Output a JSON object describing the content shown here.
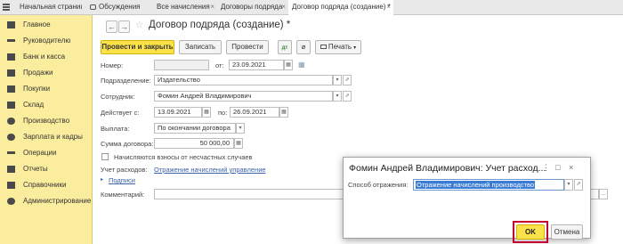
{
  "tabs": [
    {
      "label": "Начальная страница"
    },
    {
      "label": "Обсуждения"
    },
    {
      "label": "Все начисления"
    },
    {
      "label": "Договоры подряда"
    },
    {
      "label": "Договор подряда (создание) *"
    }
  ],
  "sidebar": {
    "items": [
      {
        "label": "Главное"
      },
      {
        "label": "Руководителю"
      },
      {
        "label": "Банк и касса"
      },
      {
        "label": "Продажи"
      },
      {
        "label": "Покупки"
      },
      {
        "label": "Склад"
      },
      {
        "label": "Производство"
      },
      {
        "label": "Зарплата и кадры"
      },
      {
        "label": "Операции"
      },
      {
        "label": "Отчеты"
      },
      {
        "label": "Справочники"
      },
      {
        "label": "Администрирование"
      }
    ]
  },
  "form": {
    "title": "Договор подряда (создание) *",
    "toolbar": {
      "post_close": "Провести и закрыть",
      "save": "Записать",
      "post": "Провести",
      "print": "Печать"
    },
    "fields": {
      "number_label": "Номер:",
      "number_value": "",
      "date_label": "от:",
      "date_value": "23.09.2021",
      "dept_label": "Подразделение:",
      "dept_value": "Издательство",
      "employee_label": "Сотрудник:",
      "employee_value": "Фомин Андрей Владимирович",
      "valid_from_label": "Действует с:",
      "valid_from_value": "13.09.2021",
      "valid_to_label": "по:",
      "valid_to_value": "26.09.2021",
      "payment_label": "Выплата:",
      "payment_value": "По окончании договора",
      "amount_label": "Сумма договора:",
      "amount_value": "50 000,00",
      "accident_label": "Начисляются взносы от несчастных случаев",
      "expense_label": "Учет расходов:",
      "expense_link": "Отражение начислений управление",
      "signatures_link": "Подписи",
      "comment_label": "Комментарий:"
    }
  },
  "dialog": {
    "title": "Фомин Андрей Владимирович: Учет расход...",
    "method_label": "Способ отражения:",
    "method_value": "Отражение начислений производство",
    "ok": "OK",
    "cancel": "Отмена"
  },
  "colors": {
    "sidebar_bg": "#fbed9e",
    "primary_button": "#fbe14a",
    "link": "#3a63a8",
    "highlight_frame": "#c7002d",
    "selection": "#3a7bd5"
  }
}
